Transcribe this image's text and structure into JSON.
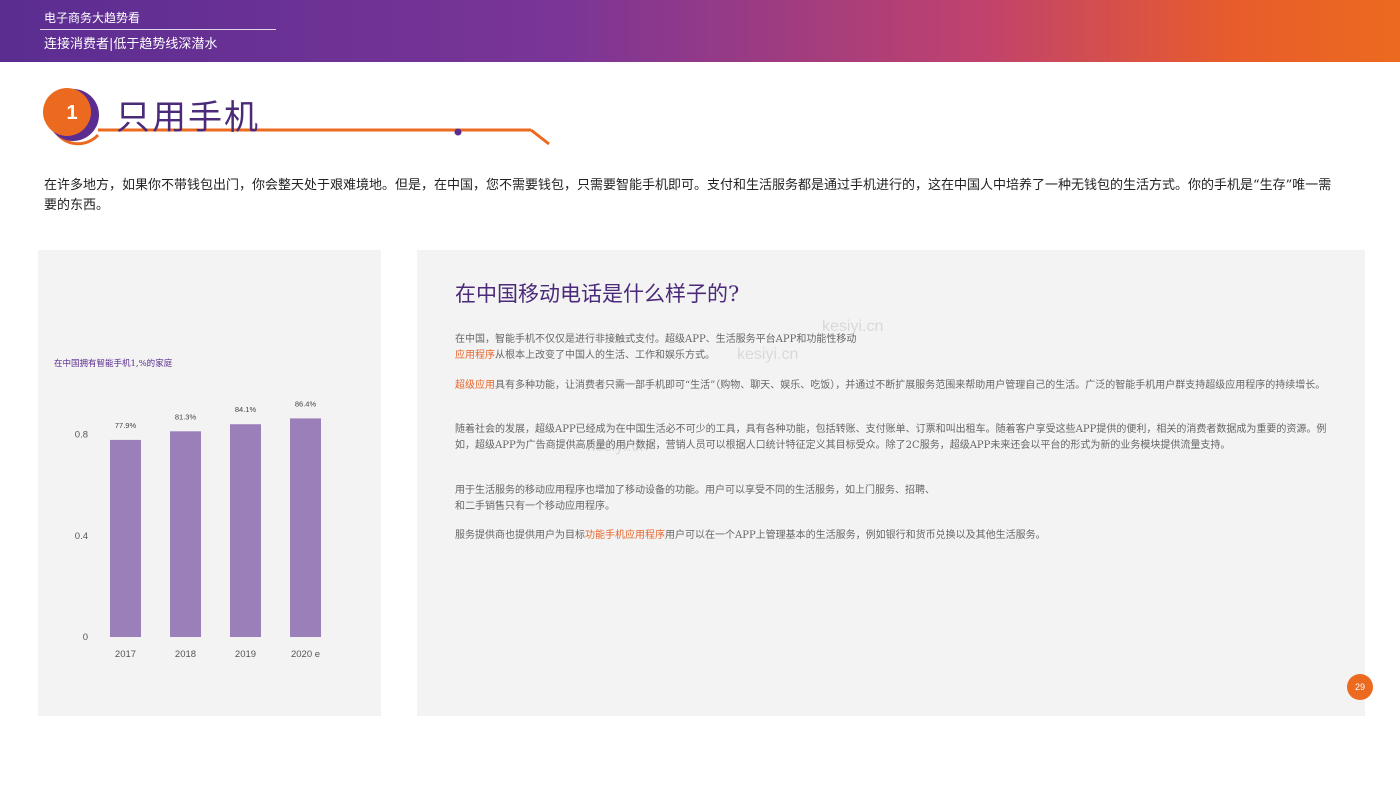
{
  "header": {
    "title": "电子商务大趋势看",
    "subtitle": "连接消费者|低于趋势线深潜水"
  },
  "section": {
    "number": "1",
    "title": "只用手机"
  },
  "intro": "在许多地方，如果你不带钱包出门，你会整天处于艰难境地。但是，在中国，您不需要钱包，只需要智能手机即可。支付和生活服务都是通过手机进行的，这在中国人中培养了一种无钱包的生活方式。你的手机是“生存”唯一需要的东西。",
  "panel": {
    "title": "在中国移动电话是什么样子的?",
    "p1_a": "在中国，智能手机不仅仅是进行非接触式支付。超级APP、生活服务平台APP和功能性移动",
    "p1_hl": "应用程序",
    "p1_b": "从根本上改变了中国人的生活、工作和娱乐方式。",
    "p2_hl": "超级应用",
    "p2_a": "具有多种功能，让消费者只需一部手机即可“生活”（购物、聊天、娱乐、吃饭），并通过不断扩展服务范围来帮助用户管理自己的生活。广泛的智能手机用户群支持超级应用程序的持续增长。",
    "p3": "随着社会的发展，超级APP已经成为在中国生活必不可少的工具，具有各种功能，包括转账、支付账单、订票和叫出租车。随着客户享受这些APP提供的便利，相关的消费者数据成为重要的资源。例如，超级APP为广告商提供高质量的用户数据，营销人员可以根据人口统计特征定义其目标受众。除了2C服务，超级APP未来还会以平台的形式为新的业务模块提供流量支持。",
    "p4_line1": "用于生活服务的移动应用程序也增加了移动设备的功能。用户可以享受不同的生活服务，如上门服务、招聘、",
    "p4_line2": "和二手销售只有一个移动应用程序。",
    "p5_a": "服务提供商也提供用户为目标",
    "p5_hl": "功能手机应用程序",
    "p5_b": "用户可以在一个APP上管理基本的生活服务，例如银行和货币兑换以及其他生活服务。"
  },
  "watermark": "kesiyi.cn",
  "page_number": "29",
  "colors": {
    "bar": "#9b7fb8",
    "accent": "#ec6a1f",
    "brand": "#5b2d91"
  },
  "chart_data": {
    "type": "bar",
    "title": "在中国拥有智能手机1,%的家庭",
    "categories": [
      "2017",
      "2018",
      "2019",
      "2020 e"
    ],
    "values": [
      0.779,
      0.813,
      0.841,
      0.864
    ],
    "data_labels": [
      "77.9%",
      "81.3%",
      "84.1%",
      "86.4%"
    ],
    "y_ticks": [
      {
        "value": 0,
        "label": "0"
      },
      {
        "value": 0.4,
        "label": "0.4"
      },
      {
        "value": 0.8,
        "label": "0.8"
      }
    ],
    "ylim": [
      0,
      1
    ],
    "grid": false,
    "legend": "none"
  }
}
